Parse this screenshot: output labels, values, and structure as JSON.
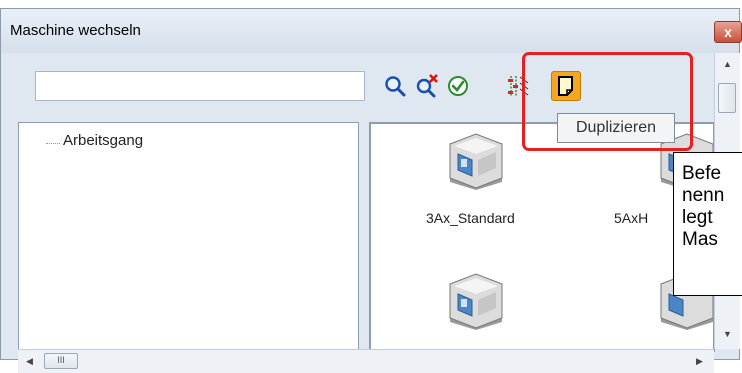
{
  "window": {
    "title": "Maschine wechseln",
    "close_label": "x"
  },
  "toolbar": {
    "search_value": "",
    "icons": [
      "search-icon",
      "clear-search-icon",
      "confirm-icon",
      "filter-icon",
      "duplicate-icon"
    ]
  },
  "tree": {
    "items": [
      {
        "label": "Arbeitsgang"
      }
    ]
  },
  "machines": [
    {
      "label": "3Ax_Standard"
    },
    {
      "label": "5AxH"
    },
    {
      "label": ""
    },
    {
      "label": ""
    }
  ],
  "tooltip": {
    "text": "Duplizieren"
  },
  "callout": {
    "lines": [
      "Befe",
      "nenn",
      "legt",
      "Mas"
    ]
  },
  "scrollbar": {
    "h_grip": "III"
  },
  "colors": {
    "highlight": "#e62020",
    "accent_orange": "#f5a623"
  }
}
